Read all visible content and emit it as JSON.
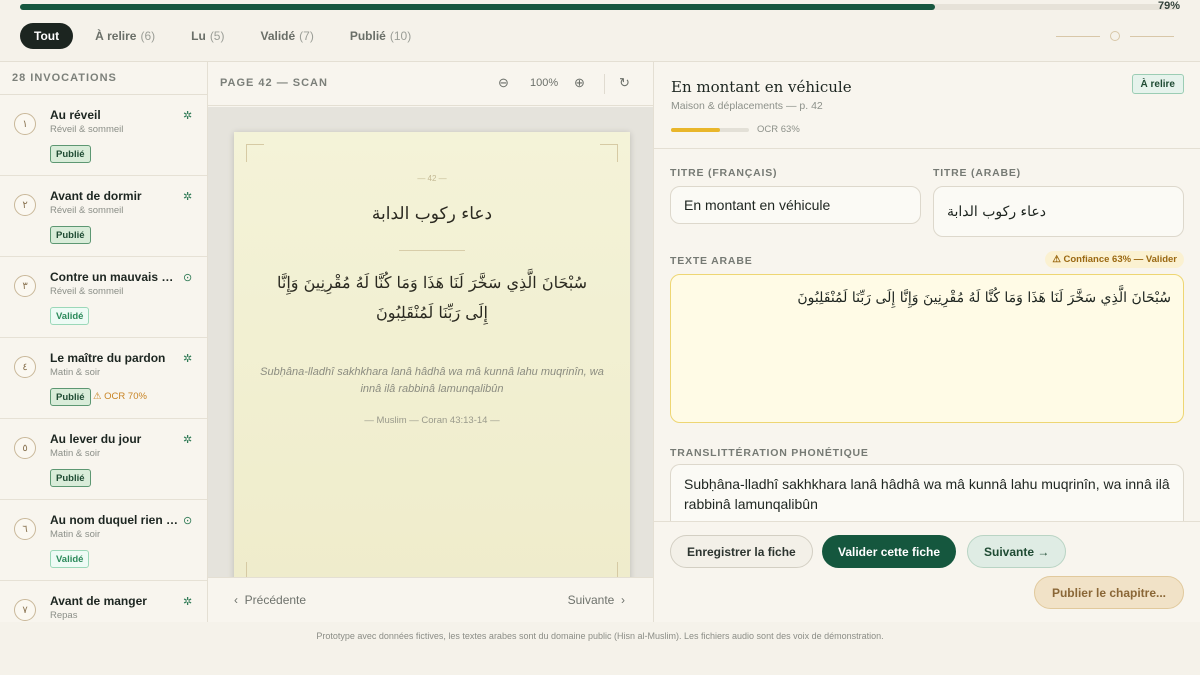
{
  "progress": {
    "value": 0.79,
    "label": "79%"
  },
  "filters": [
    {
      "label": "Tout",
      "count": "",
      "active": true
    },
    {
      "label": "À relire",
      "count": "(6)"
    },
    {
      "label": "Lu",
      "count": "(5)"
    },
    {
      "label": "Validé",
      "count": "(7)"
    },
    {
      "label": "Publié",
      "count": "(10)"
    }
  ],
  "sidebar": {
    "header": "28 INVOCATIONS",
    "items": [
      {
        "num": "١",
        "title": "Au réveil",
        "category": "Réveil & sommeil",
        "status": "Publié",
        "icon": "sparkle-icon",
        "warning": ""
      },
      {
        "num": "٢",
        "title": "Avant de dormir",
        "category": "Réveil & sommeil",
        "status": "Publié",
        "icon": "sparkle-icon",
        "warning": ""
      },
      {
        "num": "٣",
        "title": "Contre un mauvais rêve",
        "category": "Réveil & sommeil",
        "status": "Validé",
        "icon": "check-circle-icon",
        "warning": ""
      },
      {
        "num": "٤",
        "title": "Le maître du pardon",
        "category": "Matin & soir",
        "status": "Publié",
        "icon": "sparkle-icon",
        "warning": "⚠ OCR 70%"
      },
      {
        "num": "٥",
        "title": "Au lever du jour",
        "category": "Matin & soir",
        "status": "Publié",
        "icon": "sparkle-icon",
        "warning": ""
      },
      {
        "num": "٦",
        "title": "Au nom duquel rien ne nuit",
        "category": "Matin & soir",
        "status": "Validé",
        "icon": "check-circle-icon",
        "warning": ""
      },
      {
        "num": "٧",
        "title": "Avant de manger",
        "category": "Repas",
        "status": "",
        "icon": "sparkle-icon",
        "warning": ""
      }
    ]
  },
  "viewer": {
    "title": "PAGE 42 — SCAN",
    "zoom": "100%",
    "page": {
      "number": "— 42 —",
      "title_ar": "دعاء ركوب الدابة",
      "text_ar": "سُبْحَانَ الَّذِي سَخَّرَ لَنَا هَذَا وَمَا كُنَّا لَهُ مُقْرِنِينَ وَإِنَّا إِلَى رَبِّنَا لَمُنْقَلِبُونَ",
      "translit": "Subḥâna-lladhî sakhkhara lanâ hâdhâ wa mâ kunnâ lahu muqrinîn, wa innâ ilâ rabbinâ lamunqalibûn",
      "reference": "— Muslim — Coran 43:13-14 —"
    },
    "prev_label": "Précédente",
    "next_label": "Suivante"
  },
  "editor": {
    "title": "En montant en véhicule",
    "subtitle": "Maison & déplacements — p. 42",
    "ocr": {
      "value": 0.63,
      "label": "OCR 63%"
    },
    "status": "À relire",
    "fields": {
      "title_fr_label": "TITRE (FRANÇAIS)",
      "title_fr": "En montant en véhicule",
      "title_ar_label": "TITRE (ARABE)",
      "title_ar": "دعاء ركوب الدابة",
      "arabic_label": "TEXTE ARABE",
      "confidence": "Confiance 63% — Valider",
      "arabic_text": "سُبْحَانَ الَّذِي سَخَّرَ لَنَا هَذَا وَمَا كُنَّا لَهُ مُقْرِنِينَ وَإِنَّا إِلَى رَبِّنَا لَمُنْقَلِبُونَ",
      "translit_label": "TRANSLITTÉRATION PHONÉTIQUE",
      "translit_text": "Subḥâna-lladhî sakhkhara lanâ hâdhâ wa mâ kunnâ lahu muqrinîn, wa innâ ilâ rabbinâ lamunqalibûn"
    },
    "buttons": {
      "save": "Enregistrer la fiche",
      "validate": "Valider cette fiche",
      "next": "Suivante →",
      "publish": "Publier le chapitre..."
    }
  },
  "footer": "Prototype avec données fictives, les textes arabes sont du domaine public (Hisn al-Muslim). Les fichiers audio sont des voix de démonstration.",
  "colors": {
    "accent": "#15573e",
    "warning": "#e9b62a",
    "background": "#f5f2ea"
  }
}
